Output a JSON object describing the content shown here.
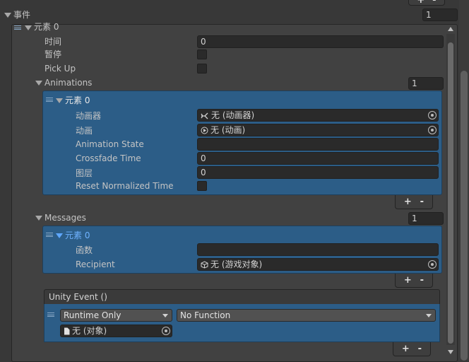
{
  "events": {
    "header": "事件",
    "count": "1"
  },
  "element0": {
    "header": "元素 0",
    "time_label": "时间",
    "time_value": "0",
    "pause_label": "暂停",
    "pickup_label": "Pick Up",
    "animations": {
      "header": "Animations",
      "count": "1",
      "element": {
        "header": "元素 0",
        "animator_label": "动画器",
        "animator_value": "无 (动画器)",
        "animation_label": "动画",
        "animation_value": "无 (动画)",
        "anim_state_label": "Animation State",
        "anim_state_value": "",
        "crossfade_label": "Crossfade Time",
        "crossfade_value": "0",
        "layer_label": "图层",
        "layer_value": "0",
        "reset_label": "Reset Normalized Time"
      },
      "plus": "+",
      "minus": "-"
    },
    "messages": {
      "header": "Messages",
      "count": "1",
      "element": {
        "header": "元素 0",
        "function_label": "函数",
        "function_value": "",
        "recipient_label": "Recipient",
        "recipient_value": "无 (游戏对象)"
      },
      "plus": "+",
      "minus": "-"
    },
    "unity_event": {
      "header": "Unity Event ()",
      "runtime_value": "Runtime Only",
      "function_value": "No Function",
      "object_value": "无 (对象)",
      "plus": "+",
      "minus": "-"
    }
  },
  "top_controls": {
    "plus": "+",
    "minus": "-"
  }
}
